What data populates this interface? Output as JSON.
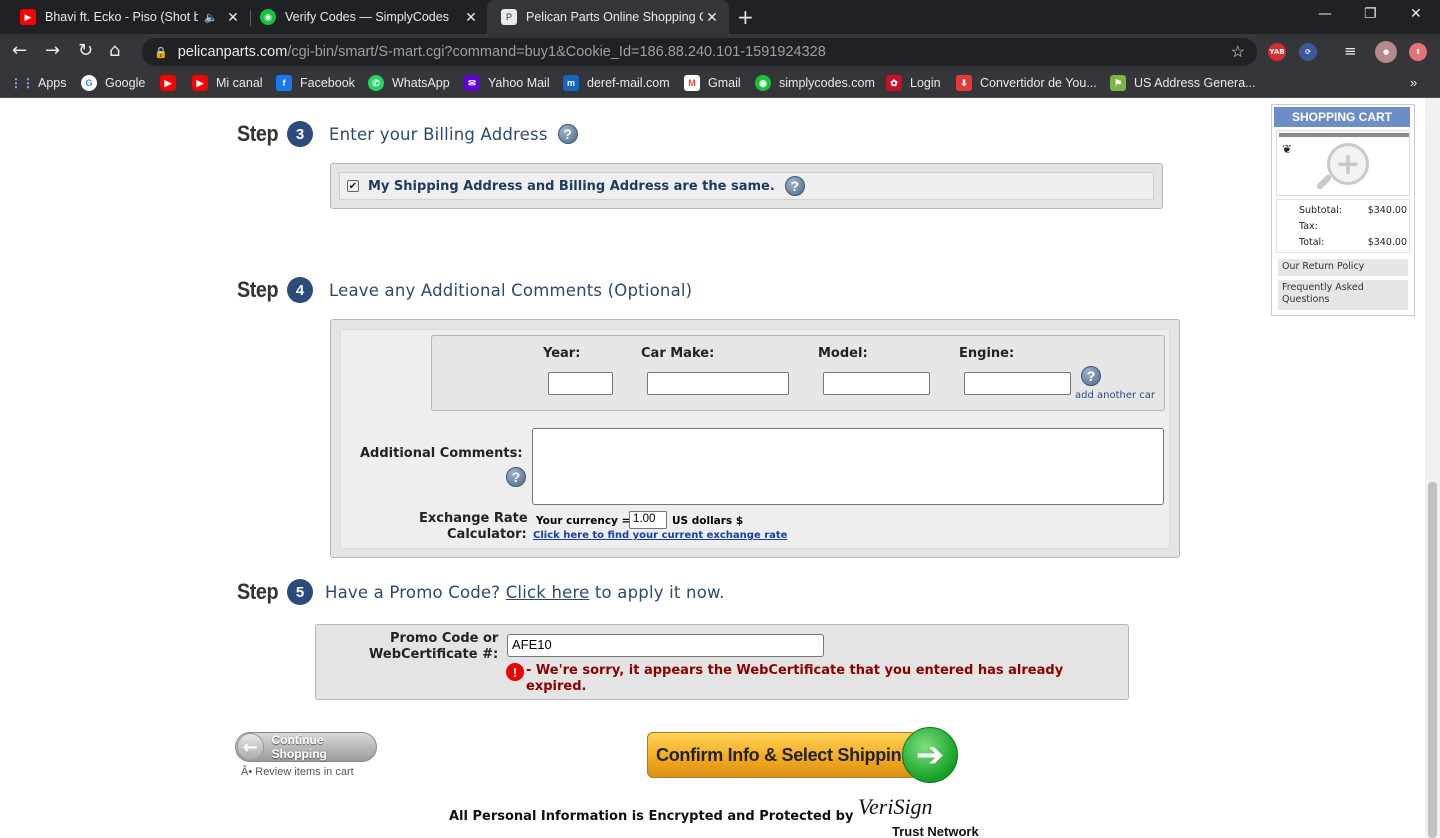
{
  "tabs": [
    {
      "title": "Bhavi ft. Ecko - Piso (Shot by",
      "favicon_color": "#ff0000",
      "favicon_name": "youtube-icon"
    },
    {
      "title": "Verify Codes — SimplyCodes",
      "favicon_color": "#17c33a",
      "favicon_name": "simplycodes-icon"
    },
    {
      "title": "Pelican Parts Online Shopping Ca",
      "favicon_color": "#1b3a6b",
      "favicon_name": "pelican-icon"
    }
  ],
  "address": {
    "host": "pelicanparts.com",
    "path": "/cgi-bin/smart/S-mart.cgi?command=buy1&Cookie_Id=186.88.240.101-1591924328"
  },
  "extensions": [
    "YAB"
  ],
  "bookmarks": [
    {
      "label": "Apps",
      "color": "#4285f4"
    },
    {
      "label": "Google",
      "color": "#4285f4"
    },
    {
      "label": "",
      "color": "#ff0000"
    },
    {
      "label": "Mi canal",
      "color": "#ff0000"
    },
    {
      "label": "Facebook",
      "color": "#1877f2"
    },
    {
      "label": "WhatsApp",
      "color": "#25d366"
    },
    {
      "label": "Yahoo Mail",
      "color": "#6001d2"
    },
    {
      "label": "deref-mail.com",
      "color": "#1565c0"
    },
    {
      "label": "Gmail",
      "color": "#ea4335"
    },
    {
      "label": "simplycodes.com",
      "color": "#17c33a"
    },
    {
      "label": "Login",
      "color": "#c8102e"
    },
    {
      "label": "Convertidor de You...",
      "color": "#e53935"
    },
    {
      "label": "US Address Genera...",
      "color": "#7cb342"
    }
  ],
  "step3": {
    "word": "Step",
    "num": "3",
    "title": "Enter your Billing Address",
    "same_address_label": "My Shipping Address and Billing Address are the same."
  },
  "step4": {
    "word": "Step",
    "num": "4",
    "title": "Leave any Additional Comments (Optional)",
    "year_label": "Year:",
    "make_label": "Car Make:",
    "model_label": "Model:",
    "engine_label": "Engine:",
    "add_car": "add another car",
    "comments_label": "Additional Comments:",
    "exchange_label_1": "Exchange Rate",
    "exchange_label_2": "Calculator:",
    "your_currency": "Your currency =",
    "currency_value": "1.00",
    "usd": "US dollars $",
    "exchange_link": "Click here to find your current exchange rate"
  },
  "step5": {
    "word": "Step",
    "num": "5",
    "title_pre": "Have a Promo Code?",
    "title_link": "Click here",
    "title_post": "to apply it now.",
    "promo_label_1": "Promo Code or",
    "promo_label_2": "WebCertificate #:",
    "promo_value": "AFE10",
    "error_1": "- We're sorry, it appears the WebCertificate that you entered has already",
    "error_2": "expired."
  },
  "buttons": {
    "continue": "Continue Shopping",
    "review": "Â• Review items in cart",
    "confirm": "Confirm Info & Select Shipping"
  },
  "security": {
    "text": "All Personal Information is Encrypted and Protected by",
    "brand": "VeriSign",
    "network": "Trust Network"
  },
  "cart": {
    "header": "SHOPPING CART",
    "rows": [
      {
        "label": "Subtotal:",
        "value": "$340.00"
      },
      {
        "label": "Tax:",
        "value": ""
      },
      {
        "label": "Total:",
        "value": "$340.00"
      }
    ],
    "links": [
      "Our Return Policy",
      "Frequently Asked Questions"
    ]
  }
}
